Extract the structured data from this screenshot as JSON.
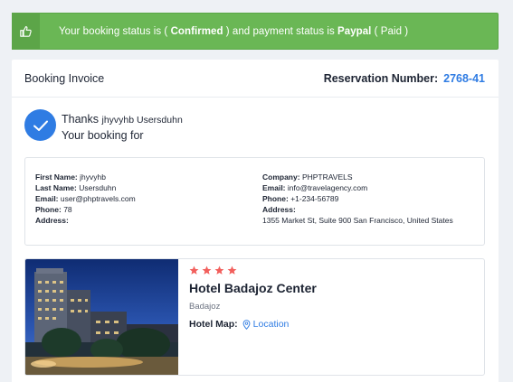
{
  "status": {
    "prefix": "Your booking status is ( ",
    "booking_status": "Confirmed",
    "middle": " ) and payment status is ",
    "payment_method": "Paypal",
    "suffix": " ( Paid )",
    "icon": "thumbs-up-icon",
    "color": "#6ab755"
  },
  "invoice": {
    "title": "Booking Invoice",
    "reservation_label": "Reservation Number:",
    "reservation_number": "2768-41"
  },
  "thanks": {
    "prefix": "Thanks",
    "name": "jhyvyhb Usersduhn",
    "line2": "Your booking for",
    "icon": "check-circle-icon",
    "color": "#2f7ce3"
  },
  "customer": {
    "first_name_label": "First Name:",
    "first_name": "jhyvyhb",
    "last_name_label": "Last Name:",
    "last_name": "Usersduhn",
    "email_label": "Email:",
    "email": "user@phptravels.com",
    "phone_label": "Phone:",
    "phone": "78",
    "address_label": "Address:",
    "address": ""
  },
  "company": {
    "company_label": "Company:",
    "company": "PHPTRAVELS",
    "email_label": "Email:",
    "email": "info@travelagency.com",
    "phone_label": "Phone:",
    "phone": "+1-234-56789",
    "address_label": "Address:",
    "address": "1355 Market St, Suite 900 San Francisco, United States"
  },
  "hotel": {
    "stars": 4,
    "name": "Hotel Badajoz Center",
    "city": "Badajoz",
    "map_label": "Hotel Map:",
    "map_link": "Location",
    "star_color": "#f25f5c"
  }
}
